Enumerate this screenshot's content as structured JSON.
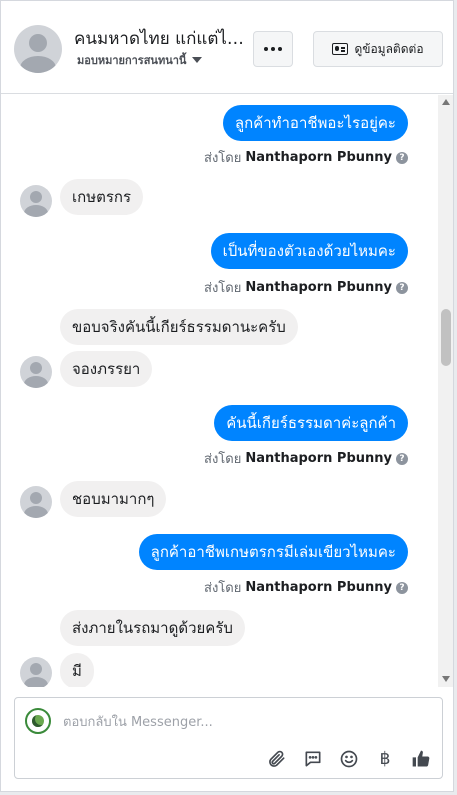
{
  "header": {
    "title": "คนมหาดไทย แก่แต่ไฟ...",
    "subtitle": "มอบหมายการสนทนานี้",
    "contact_button_label": "ดูข้อมูลติดต่อ"
  },
  "sender_prefix": "ส่งโดย",
  "sender_name": "Nanthaporn Pbunny",
  "help_glyph": "?",
  "messages": [
    {
      "dir": "out",
      "text": "ลูกค้าทำอาชีพอะไรอยู่คะ",
      "sent_by": true
    },
    {
      "dir": "in",
      "text": "เกษตรกร",
      "avatar": true
    },
    {
      "dir": "out",
      "text": "เป็นที่ของตัวเองด้วยไหมคะ",
      "sent_by": true
    },
    {
      "dir": "in",
      "text": "ขอบจริงคันนี้เกียร์ธรรมดานะครับ",
      "avatar": false
    },
    {
      "dir": "in",
      "text": "จองภรรยา",
      "avatar": true
    },
    {
      "dir": "out",
      "text": "คันนี้เกียร์ธรรมดาค่ะลูกค้า",
      "sent_by": true
    },
    {
      "dir": "in",
      "text": "ชอบมามากๆ",
      "avatar": true
    },
    {
      "dir": "out",
      "text": "ลูกค้าอาชีพเกษตรกรมีเล่มเขียวไหมคะ",
      "sent_by": true
    },
    {
      "dir": "in",
      "text": "ส่งภายในรถมาดูด้วยครับ",
      "avatar": false
    },
    {
      "dir": "in",
      "text": "มี",
      "avatar": true
    }
  ],
  "composer": {
    "placeholder": "ตอบกลับใน Messenger...",
    "baht_glyph": "฿"
  },
  "colors": {
    "outgoing_bubble": "#0084ff",
    "incoming_bubble": "#f1f0f0"
  }
}
